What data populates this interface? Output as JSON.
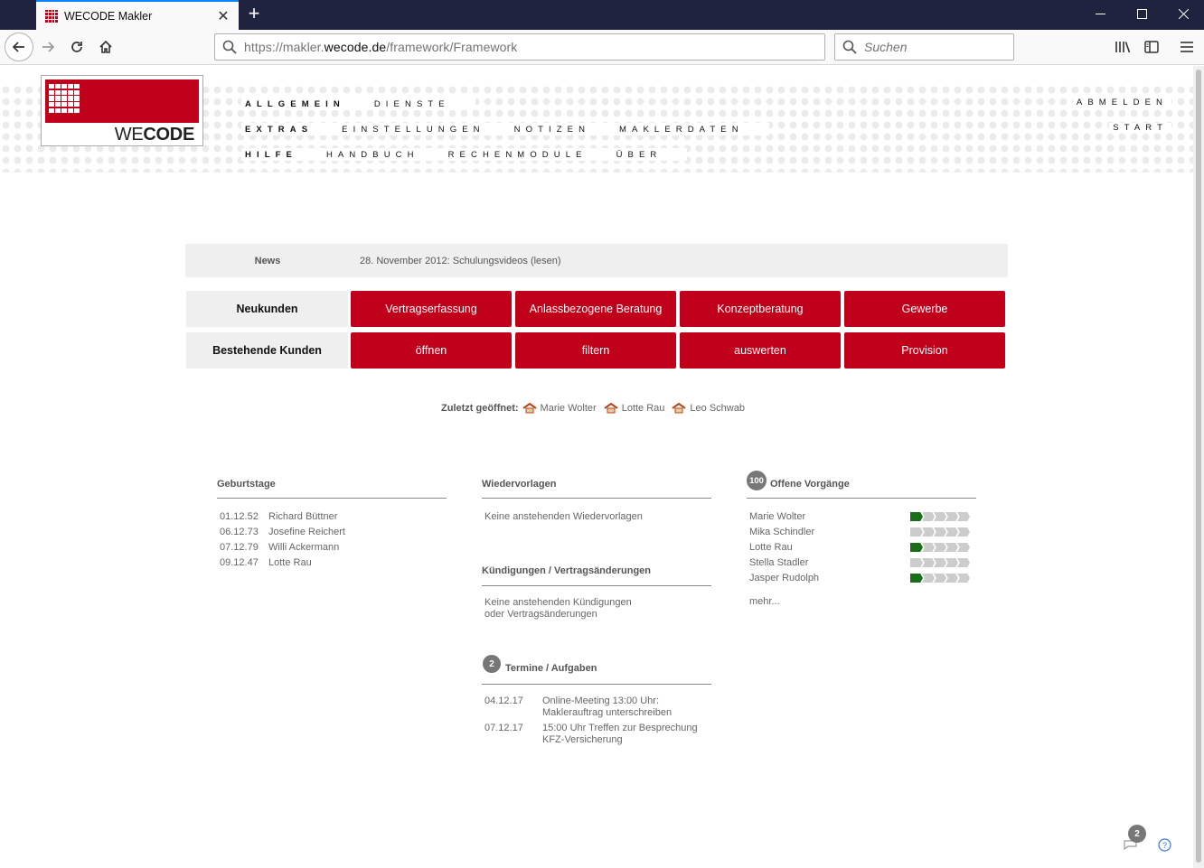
{
  "browser": {
    "tab_title": "WECODE Makler",
    "new_tab": "+",
    "url_prefix": "https://makler.",
    "url_domain": "wecode.de",
    "url_path": "/framework/Framework",
    "search_placeholder": "Suchen"
  },
  "logo": {
    "text_light": "WE",
    "text_bold": "CODE"
  },
  "menu": {
    "rows": [
      {
        "head": "ALLGEMEIN",
        "items": [
          "DIENSTE"
        ],
        "right": "ABMELDEN"
      },
      {
        "head": "EXTRAS",
        "items": [
          "EINSTELLUNGEN",
          "NOTIZEN",
          "MAKLERDATEN"
        ],
        "right": "START"
      },
      {
        "head": "HILFE",
        "items": [
          "HANDBUCH",
          "RECHENMODULE",
          "ÜBER"
        ],
        "right": ""
      }
    ]
  },
  "news": {
    "label": "News",
    "text": "28. November 2012: Schulungsvideos (lesen)"
  },
  "actions": {
    "new_customers": {
      "label": "Neukunden",
      "buttons": [
        "Vertragserfassung",
        "Anlassbezogene Beratung",
        "Konzeptberatung",
        "Gewerbe"
      ]
    },
    "existing_customers": {
      "label": "Bestehende Kunden",
      "buttons": [
        "öffnen",
        "filtern",
        "auswerten",
        "Provision"
      ]
    }
  },
  "recent": {
    "label": "Zuletzt geöffnet:",
    "items": [
      "Marie Wolter",
      "Lotte Rau",
      "Leo Schwab"
    ]
  },
  "birthdays": {
    "title": "Geburtstage",
    "items": [
      {
        "date": "01.12.52",
        "name": "Richard Büttner"
      },
      {
        "date": "06.12.73",
        "name": "Josefine Reichert"
      },
      {
        "date": "07.12.79",
        "name": "Willi Ackermann"
      },
      {
        "date": "09.12.47",
        "name": "Lotte Rau"
      }
    ]
  },
  "resubmissions": {
    "title": "Wiedervorlagen",
    "empty": "Keine anstehenden Wiedervorlagen"
  },
  "cancellations": {
    "title": "Kündigungen / Vertragsänderungen",
    "empty_line1": "Keine anstehenden Kündigungen",
    "empty_line2": "oder Vertragsänderungen"
  },
  "appointments": {
    "title": "Termine / Aufgaben",
    "count": "2",
    "items": [
      {
        "date": "04.12.17",
        "line1": "Online-Meeting 13:00 Uhr:",
        "line2": "Maklerauftrag unterschreiben"
      },
      {
        "date": "07.12.17",
        "line1": "15:00 Uhr Treffen zur Besprechung",
        "line2": "KFZ-Versicherung"
      }
    ]
  },
  "open_processes": {
    "title": "Offene Vorgänge",
    "count": "100",
    "items": [
      {
        "name": "Marie Wolter",
        "steps_done": 1,
        "steps_total": 5
      },
      {
        "name": "Mika Schindler",
        "steps_done": 0,
        "steps_total": 5
      },
      {
        "name": "Lotte Rau",
        "steps_done": 1,
        "steps_total": 5
      },
      {
        "name": "Stella Stadler",
        "steps_done": 0,
        "steps_total": 5
      },
      {
        "name": "Jasper Rudolph",
        "steps_done": 1,
        "steps_total": 5
      }
    ],
    "more": "mehr..."
  },
  "footer": {
    "messages_count": "2"
  },
  "colors": {
    "brand_red": "#c0001a",
    "progress_green": "#1a6e1a",
    "chrome_dark": "#202340"
  },
  "icons": [
    "back-arrow-icon",
    "forward-arrow-icon",
    "reload-icon",
    "home-icon",
    "search-icon",
    "library-icon",
    "sidebar-icon",
    "hamburger-menu-icon",
    "house-icon",
    "chat-icon",
    "help-icon"
  ]
}
